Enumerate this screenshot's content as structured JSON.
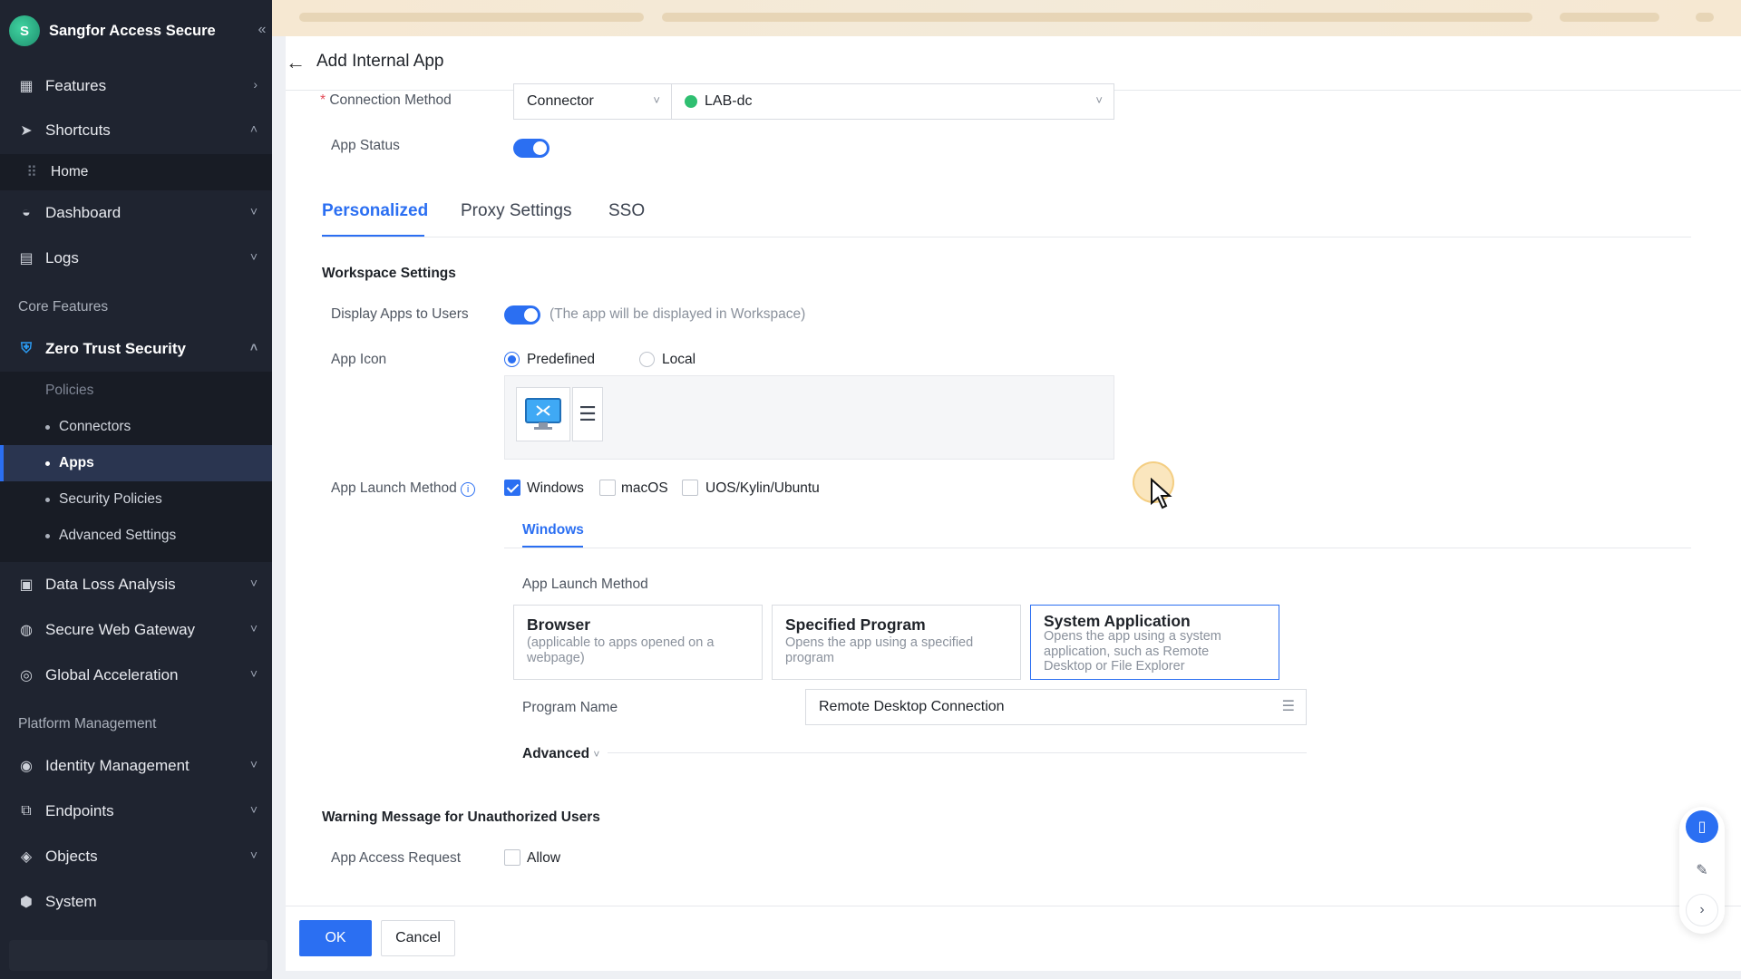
{
  "app": {
    "brand": "Sangfor Access Secure"
  },
  "sidebar": {
    "items": [
      {
        "label": "Features"
      },
      {
        "label": "Shortcuts"
      },
      {
        "label": "Home"
      },
      {
        "label": "Dashboard"
      },
      {
        "label": "Logs"
      }
    ],
    "core_title": "Core Features",
    "zero_trust": "Zero Trust Security",
    "policies": "Policies",
    "sub": [
      "Connectors",
      "Apps",
      "Security Policies",
      "Advanced Settings"
    ],
    "more": [
      "Data Loss Analysis",
      "Secure Web Gateway",
      "Global Acceleration"
    ],
    "platform_title": "Platform Management",
    "platform": [
      "Identity Management",
      "Endpoints",
      "Objects",
      "System"
    ]
  },
  "header": {
    "title": "Add Internal App"
  },
  "form": {
    "connection_method_label": "Connection Method",
    "connection_method_value": "Connector",
    "connector_value": "LAB-dc",
    "app_status_label": "App Status",
    "tabs": [
      "Personalized",
      "Proxy Settings",
      "SSO"
    ],
    "workspace_title": "Workspace Settings",
    "display_label": "Display Apps to Users",
    "display_hint": "(The app will be displayed in Workspace)",
    "icon_label": "App Icon",
    "icon_opt_predefined": "Predefined",
    "icon_opt_local": "Local",
    "launch_label": "App Launch Method",
    "os_windows": "Windows",
    "os_macos": "macOS",
    "os_uos": "UOS/Kylin/Ubuntu",
    "subtab": "Windows",
    "launch_method_title": "App Launch Method",
    "cards": [
      {
        "title": "Browser",
        "desc1": "(applicable to apps opened on a",
        "desc2": "webpage)"
      },
      {
        "title": "Specified Program",
        "desc1": "Opens the app using a specified",
        "desc2": "program"
      },
      {
        "title": "System Application",
        "desc1": "Opens the app using a system",
        "desc2": "application, such as Remote",
        "desc3": "Desktop or File Explorer"
      }
    ],
    "program_label": "Program Name",
    "program_value": "Remote Desktop Connection",
    "advanced": "Advanced",
    "warning_title": "Warning Message for Unauthorized Users",
    "access_label": "App Access Request",
    "allow": "Allow"
  },
  "footer": {
    "ok": "OK",
    "cancel": "Cancel"
  },
  "colors": {
    "accent": "#2b6ff2",
    "sidebar": "#1f2430"
  }
}
